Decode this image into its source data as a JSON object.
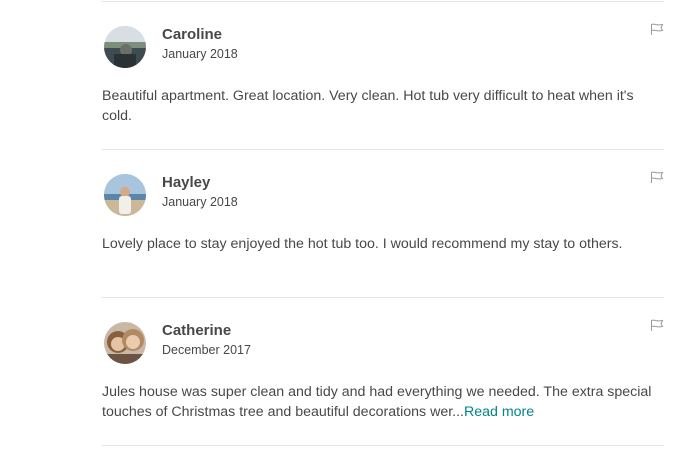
{
  "reviews": [
    {
      "name": "Caroline",
      "date": "January 2018",
      "text": "Beautiful apartment. Great location. Very clean. Hot tub very difficult to heat when it's cold."
    },
    {
      "name": "Hayley",
      "date": "January 2018",
      "text": "Lovely place to stay enjoyed the hot tub too. I would recommend my stay to others."
    },
    {
      "name": "Catherine",
      "date": "December 2017",
      "text": "Jules house was super clean and tidy and had everything we needed. The extra special touches of Christmas tree and beautiful decorations wer...",
      "read_more": "Read more"
    }
  ],
  "icons": {
    "report": "flag-icon"
  },
  "colors": {
    "text": "#484848",
    "link": "#008489",
    "divider": "#e4e4e4"
  }
}
